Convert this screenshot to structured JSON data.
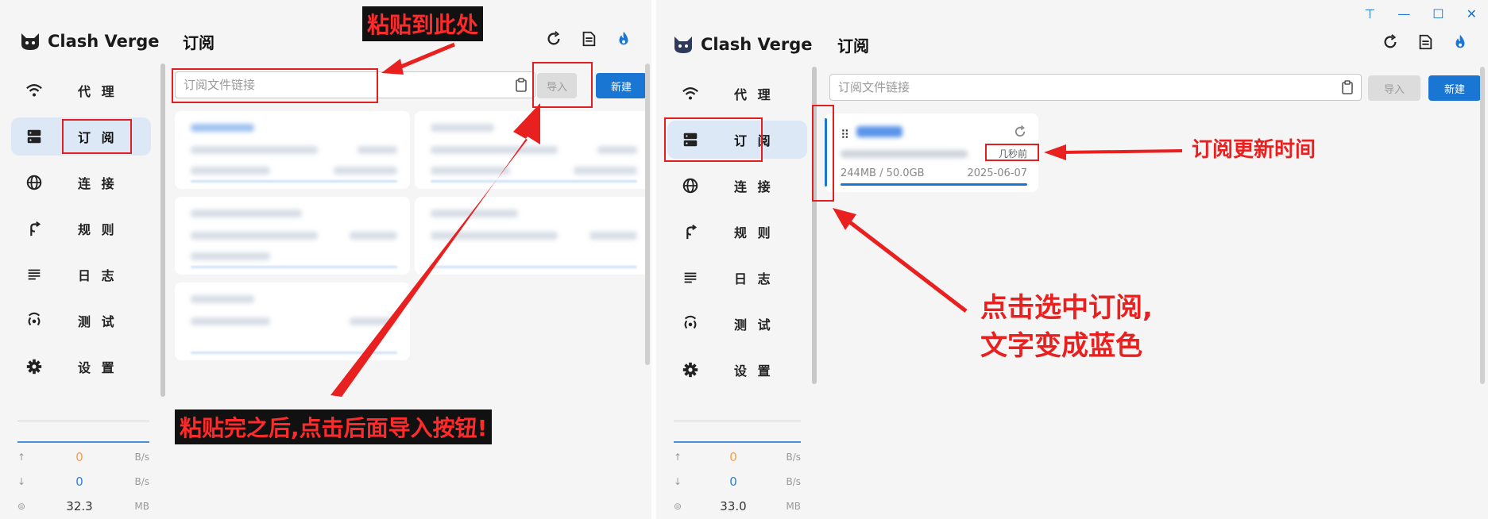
{
  "app_name": "Clash Verge",
  "nav_items": [
    {
      "label": "代 理",
      "icon": "wifi-icon"
    },
    {
      "label": "订 阅",
      "icon": "server-icon"
    },
    {
      "label": "连 接",
      "icon": "globe-icon"
    },
    {
      "label": "规 则",
      "icon": "fork-icon"
    },
    {
      "label": "日 志",
      "icon": "lines-icon"
    },
    {
      "label": "测 试",
      "icon": "radar-icon"
    },
    {
      "label": "设 置",
      "icon": "gear-icon"
    }
  ],
  "page_title": "订阅",
  "url_input": {
    "placeholder": "订阅文件链接"
  },
  "import_label": "导入",
  "new_label": "新建",
  "left": {
    "traffic": {
      "up_value": "0",
      "down_value": "0",
      "memory_value": "32.3",
      "speed_unit": "B/s",
      "memory_unit": "MB"
    },
    "annotations": {
      "paste_here": "粘贴到此处",
      "after_paste": "粘贴完之后,点击后面导入按钮!"
    }
  },
  "right": {
    "traffic": {
      "up_value": "0",
      "down_value": "0",
      "memory_value": "33.0",
      "speed_unit": "B/s",
      "memory_unit": "MB"
    },
    "card": {
      "updated": "几秒前",
      "usage": "244MB / 50.0GB",
      "date": "2025-06-07",
      "usage_fraction": 0.005
    },
    "annotations": {
      "update_time": "订阅更新时间",
      "click_select_1": "点击选中订阅,",
      "click_select_2": "文字变成蓝色"
    }
  },
  "colors": {
    "accent": "#1976d2",
    "annotation": "#e8201f",
    "active_nav": "#dde8f6"
  }
}
